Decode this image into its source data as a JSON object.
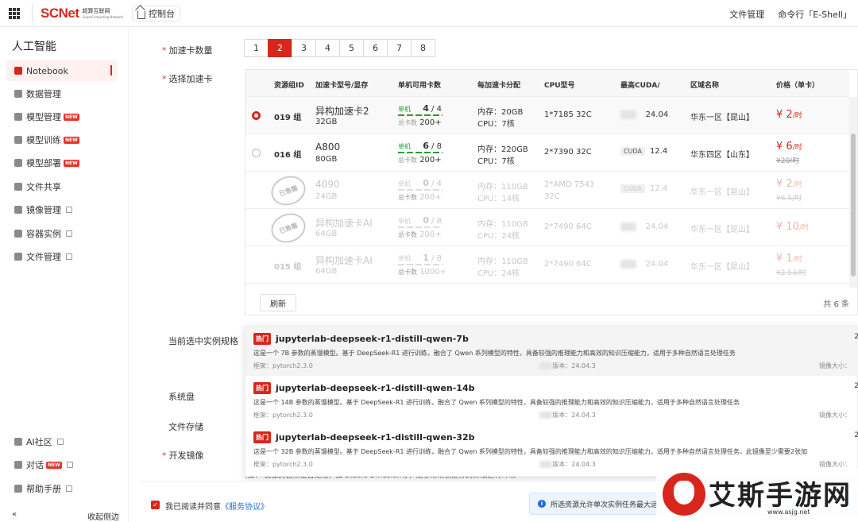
{
  "topbar": {
    "brand": "SCNet",
    "brand_cn": "超算互联网",
    "brand_en": "SuperComputing Network",
    "console": "控制台",
    "file_mgmt": "文件管理",
    "cmdline": "命令行「E-Shell」"
  },
  "sidebar": {
    "title": "人工智能",
    "items": [
      {
        "label": "Notebook",
        "icon": "notebook-icon"
      },
      {
        "label": "数据管理",
        "icon": "database-icon"
      },
      {
        "label": "模型管理",
        "icon": "cube-icon",
        "badge": "NEW"
      },
      {
        "label": "模型训练",
        "icon": "train-icon",
        "badge": "NEW"
      },
      {
        "label": "模型部署",
        "icon": "deploy-icon",
        "badge": "NEW"
      },
      {
        "label": "文件共享",
        "icon": "file-share-icon"
      },
      {
        "label": "镜像管理",
        "icon": "image-icon"
      },
      {
        "label": "容器实例",
        "icon": "container-icon"
      },
      {
        "label": "文件管理",
        "icon": "folder-icon"
      }
    ],
    "bottom_items": [
      {
        "label": "AI社区",
        "icon": "community-icon"
      },
      {
        "label": "对话",
        "icon": "chat-icon",
        "badge": "NEW"
      },
      {
        "label": "帮助手册",
        "icon": "book-icon"
      }
    ],
    "collapse_label": "收起侧边",
    "collapse_icon": "«"
  },
  "form": {
    "card_count_label": "加速卡数量",
    "card_counts": [
      "1",
      "2",
      "3",
      "4",
      "5",
      "6",
      "7",
      "8"
    ],
    "card_count_selected": "2",
    "select_card_label": "选择加速卡",
    "current_spec_label": "当前选中实例规格",
    "system_disk_label": "系统盘",
    "file_storage_label": "文件存储",
    "dev_image_label": "开发镜像"
  },
  "table": {
    "headers": [
      "资源组ID",
      "加速卡型号/显存",
      "单机可用卡数",
      "每加速卡分配",
      "CPU型号",
      "最高CUDA/",
      "区域名称",
      "价格（单卡）"
    ],
    "rows": [
      {
        "id": "019 组",
        "card": "异构加速卡2",
        "mem": "32GB",
        "single_lbl": "单机",
        "avail": "4",
        "of": "4",
        "total_lbl": "总卡数",
        "total": "200+",
        "ram": "内存：20GB",
        "cpu_alloc": "CPU：7核",
        "cpu_model": "1*7185 32C",
        "cuda_tag": "",
        "cuda": "24.04",
        "region": "华东一区【昆山】",
        "price": "¥ 2",
        "unit": "/时",
        "old_price": "",
        "selected": true,
        "disabled": false,
        "stamp": ""
      },
      {
        "id": "016 组",
        "card": "A800",
        "mem": "80GB",
        "single_lbl": "单机",
        "avail": "6",
        "of": "8",
        "total_lbl": "总卡数",
        "total": "200+",
        "ram": "内存：220GB",
        "cpu_alloc": "CPU：7核",
        "cpu_model": "2*7390 32C",
        "cuda_tag": "CUDA",
        "cuda": "12.4",
        "region": "华东四区【山东】",
        "price": "¥ 6",
        "unit": "/时",
        "old_price": "¥20/时",
        "selected": false,
        "disabled": false,
        "stamp": ""
      },
      {
        "id": "",
        "card": "4090",
        "mem": "24GB",
        "single_lbl": "单机",
        "avail": "0",
        "of": "4",
        "total_lbl": "总卡数",
        "total": "200+",
        "ram": "内存：110GB",
        "cpu_alloc": "CPU：14核",
        "cpu_model": "2*AMD 7543 32C",
        "cuda_tag": "CUDA",
        "cuda": "12.4",
        "region": "华东一区【昆山】",
        "price": "¥ 2",
        "unit": "/时",
        "old_price": "¥6.5/时",
        "selected": false,
        "disabled": true,
        "stamp": "已售罄"
      },
      {
        "id": "",
        "card": "异构加速卡AI",
        "mem": "64GB",
        "single_lbl": "单机",
        "avail": "0",
        "of": "8",
        "total_lbl": "总卡数",
        "total": "200+",
        "ram": "内存：110GB",
        "cpu_alloc": "CPU：24核",
        "cpu_model": "2*7490 64C",
        "cuda_tag": "",
        "cuda": "24.04",
        "region": "华东一区【昆山】",
        "price": "¥ 10",
        "unit": "/时",
        "old_price": "",
        "selected": false,
        "disabled": true,
        "stamp": "已售罄"
      },
      {
        "id": "015 组",
        "card": "异构加速卡AI",
        "mem": "64GB",
        "single_lbl": "单机",
        "avail": "1",
        "of": "8",
        "total_lbl": "总卡数",
        "total": "1000+",
        "ram": "内存：110GB",
        "cpu_alloc": "CPU：24核",
        "cpu_model": "2*7490 64C",
        "cuda_tag": "",
        "cuda": "24.04",
        "region": "华东一区【昆山】",
        "price": "¥ 1",
        "unit": "/时",
        "old_price": "¥2.53/时",
        "selected": false,
        "disabled": true,
        "stamp": ""
      }
    ],
    "refresh": "刷新",
    "total": "共 6 条"
  },
  "images": [
    {
      "tag": "热门",
      "name": "jupyterlab-deepseek-r1-distill-qwen-7b",
      "desc": "这是一个 7B 参数的蒸馏模型。基于 DeepSeek-R1 进行训练，融合了 Qwen 系列模型的特性，具备较强的推理能力和高效的知识压缩能力，适用于多种自然语言处理任务",
      "framework": "框架：pytorch2.3.0",
      "version": "版本：24.04.3",
      "size": "镜像大小：",
      "num": "2"
    },
    {
      "tag": "热门",
      "name": "jupyterlab-deepseek-r1-distill-qwen-14b",
      "desc": "这是一个 14B 参数的蒸馏模型。基于 DeepSeek-R1 进行训练，融合了 Qwen 系列模型的特性，具备较强的推理能力和高效的知识压缩能力，适用于多种自然语言处理任务",
      "framework": "框架：pytorch2.3.0",
      "version": "版本：24.04.3",
      "size": "镜像大小：",
      "num": "2"
    },
    {
      "tag": "热门",
      "name": "jupyterlab-deepseek-r1-distill-qwen-32b",
      "desc": "这是一个 32B 参数的蒸馏模型。基于 DeepSeek-R1 进行训练，融合了 Qwen 系列模型的特性，具备较强的推理能力和高效的知识压缩能力，适用于多种自然语言处理任务，此镜像至少需要2张加",
      "framework": "框架：pytorch2.3.0",
      "version": "版本：24.04.3",
      "size": "镜像大小：",
      "num": "2"
    }
  ],
  "bottom_strip": "(如： 镜像的自然语言处理，如 Stable Diffusion等，能够帮助创建你的算法运行环境",
  "footer": {
    "agree_text": "我已阅读并同意",
    "agree_link": "《服务协议》",
    "notice": "所选资源允许单次实例任务最大运"
  },
  "watermark": {
    "text": "艾斯手游网",
    "url": "www.asjg.net"
  },
  "colors": {
    "accent": "#d9261c",
    "link": "#1b6fd6"
  }
}
